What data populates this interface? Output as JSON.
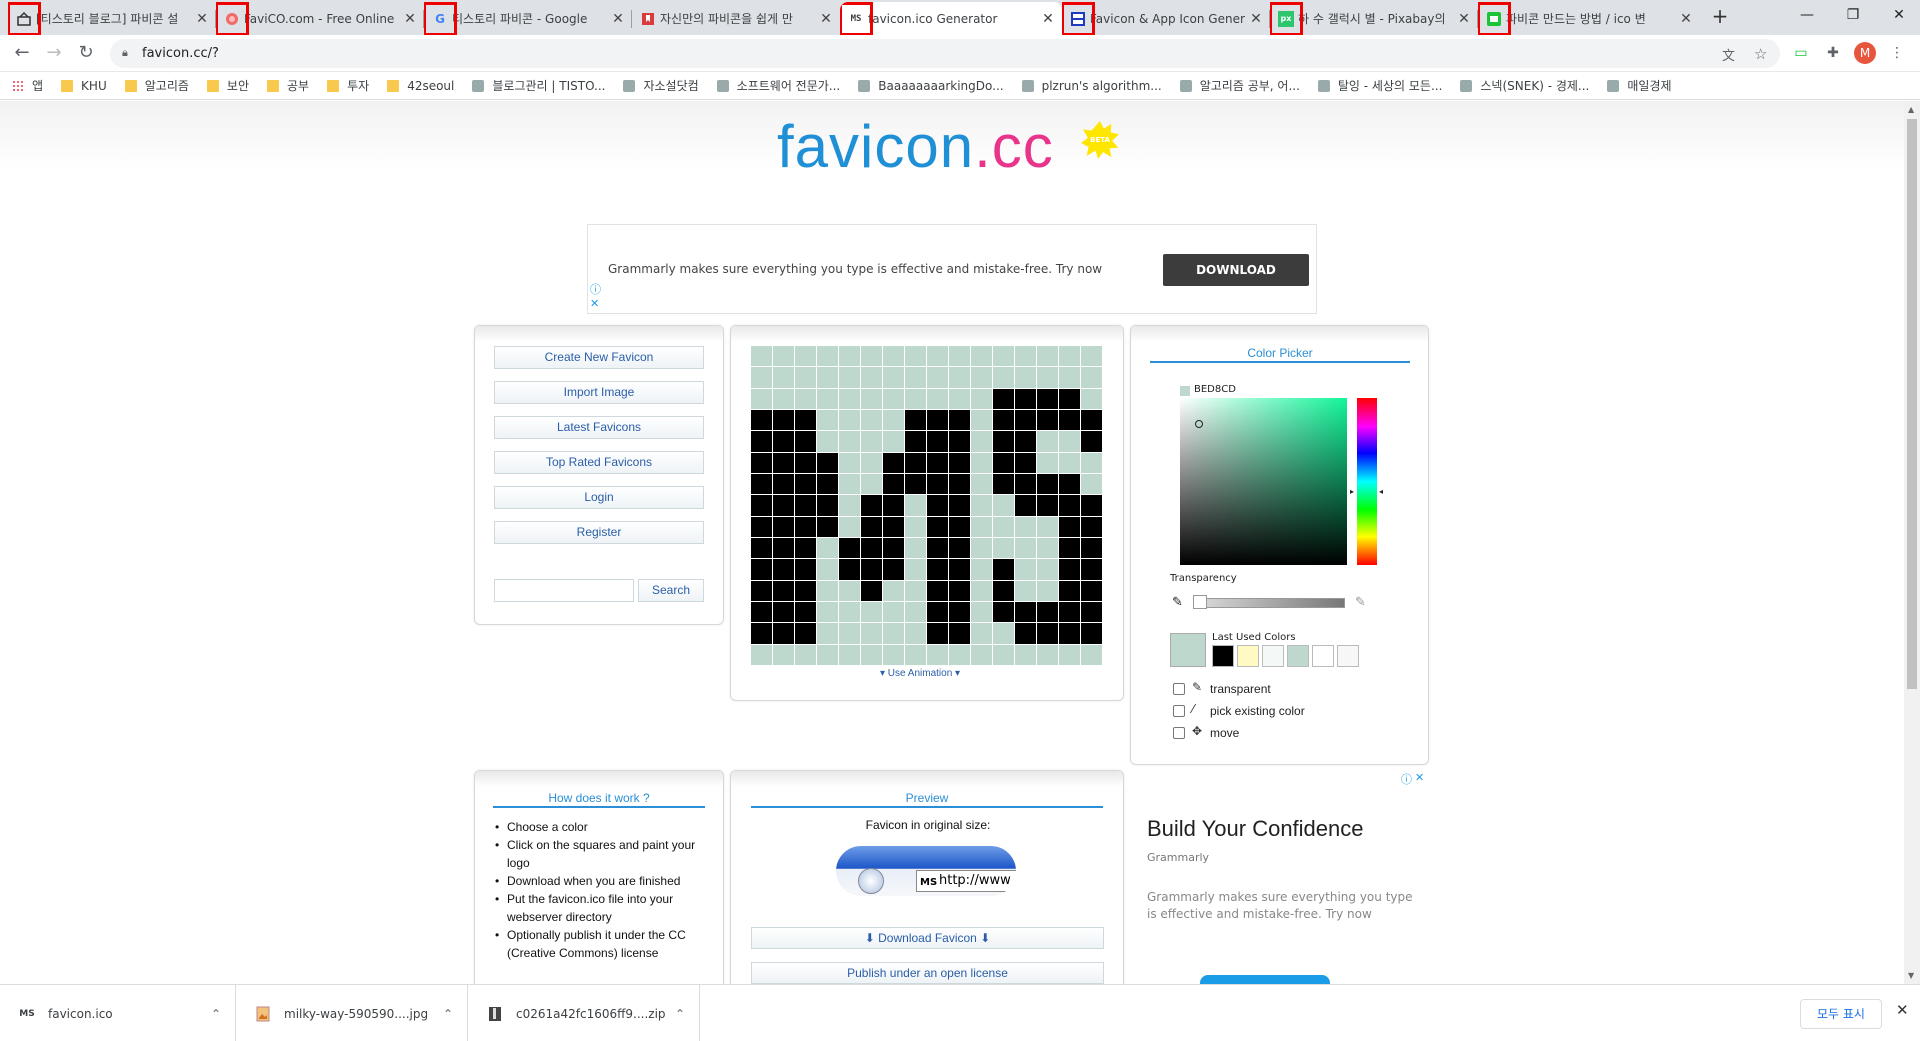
{
  "tabs": [
    {
      "title": "[티스토리 블로그] 파비콘 설",
      "favicon": "tistory-icon",
      "highlight": true
    },
    {
      "title": "FaviCO.com - Free Online",
      "favicon": "favico-icon",
      "highlight": true
    },
    {
      "title": "티스토리 파비콘 - Google",
      "favicon": "google-icon",
      "highlight": true
    },
    {
      "title": "자신만의 파비콘을 쉽게 만",
      "favicon": "bookmark-red-icon",
      "highlight": false
    },
    {
      "title": "favicon.ico Generator",
      "favicon": "ms-icon",
      "highlight": true,
      "active": true
    },
    {
      "title": "Favicon & App Icon Gener",
      "favicon": "realfavicon-icon",
      "highlight": true
    },
    {
      "title": "하 수 갤럭시 별 - Pixabay의",
      "favicon": "pixabay-icon",
      "highlight": true
    },
    {
      "title": "파비콘 만드는 방법 / ico 변",
      "favicon": "naver-icon",
      "highlight": true
    }
  ],
  "address": {
    "url": "favicon.cc/?"
  },
  "bookmarks": [
    {
      "label": "앱",
      "icon": "apps-grid-icon"
    },
    {
      "label": "KHU",
      "icon": "folder-icon"
    },
    {
      "label": "알고리즘",
      "icon": "folder-icon"
    },
    {
      "label": "보안",
      "icon": "folder-icon"
    },
    {
      "label": "공부",
      "icon": "folder-icon"
    },
    {
      "label": "투자",
      "icon": "folder-icon"
    },
    {
      "label": "42seoul",
      "icon": "folder-icon"
    },
    {
      "label": "블로그관리 | TISTO...",
      "icon": "tistory-icon"
    },
    {
      "label": "자소설닷컴",
      "icon": "pen-icon"
    },
    {
      "label": "소프트웨어 전문가...",
      "icon": "site-icon"
    },
    {
      "label": "BaaaaaaaarkingDo...",
      "icon": "site-icon"
    },
    {
      "label": "plzrun's algorithm...",
      "icon": "site-icon"
    },
    {
      "label": "알고리즘 공부, 어...",
      "icon": "site-icon"
    },
    {
      "label": "탈잉 - 세상의 모든...",
      "icon": "site-icon"
    },
    {
      "label": "스넥(SNEK) - 경제...",
      "icon": "site-icon"
    },
    {
      "label": "매일경제",
      "icon": "site-icon"
    }
  ],
  "logo": {
    "favicon": "favicon",
    "cc": ".cc",
    "beta": "BETA"
  },
  "top_ad": {
    "text": "Grammarly makes sure everything you type is effective and mistake-free. Try now",
    "button": "DOWNLOAD"
  },
  "menu": {
    "create": "Create New Favicon",
    "import": "Import Image",
    "latest": "Latest Favicons",
    "top_rated": "Top Rated Favicons",
    "login": "Login",
    "register": "Register",
    "search_button": "Search"
  },
  "editor": {
    "use_animation": "▾ Use Animation ▾",
    "bg_color": "#bed8cd",
    "pixels": [
      "0000000000000000",
      "0000000000000000",
      "0000000000011110",
      "1110000111011111",
      "1110000111011001",
      "1111001111011000",
      "1111001111011110",
      "1111011011001111",
      "1111011011000011",
      "1110111011000011",
      "1110111011010011",
      "1110010011010011",
      "1110000011011111",
      "1110000011001111",
      "0000000000000000"
    ]
  },
  "color_picker": {
    "title": "Color Picker",
    "hex": "BED8CD",
    "transparency_label": "Transparency",
    "last_used_label": "Last Used Colors",
    "last_used": [
      "#000000",
      "#fff9c4",
      "#f4f8f6",
      "#bed8cd",
      "#ffffff",
      "#f7f7f7"
    ],
    "option_transparent": "transparent",
    "option_pick": "pick existing color",
    "option_move": "move"
  },
  "how": {
    "title": "How does it work ?",
    "steps": [
      "Choose a color",
      "Click on the squares and paint your logo",
      "Download when you are finished",
      "Put the favicon.ico file into your webserver directory",
      "Optionally publish it under the CC (Creative Commons) license"
    ]
  },
  "preview": {
    "title": "Preview",
    "label": "Favicon in original size:",
    "address_text": "http://www",
    "download": "⬇ Download Favicon ⬇",
    "publish": "Publish under an open license"
  },
  "right_ad": {
    "title": "Build Your Confidence",
    "brand": "Grammarly",
    "text": "Grammarly makes sure everything you type is effective and mistake-free. Try now"
  },
  "downloads": [
    {
      "name": "favicon.ico",
      "icon": "ms-icon"
    },
    {
      "name": "milky-way-590590....jpg",
      "icon": "image-file-icon"
    },
    {
      "name": "c0261a42fc1606ff9....zip",
      "icon": "zip-file-icon"
    }
  ],
  "download_bar": {
    "show_all": "모두 표시"
  },
  "profile_initial": "M"
}
